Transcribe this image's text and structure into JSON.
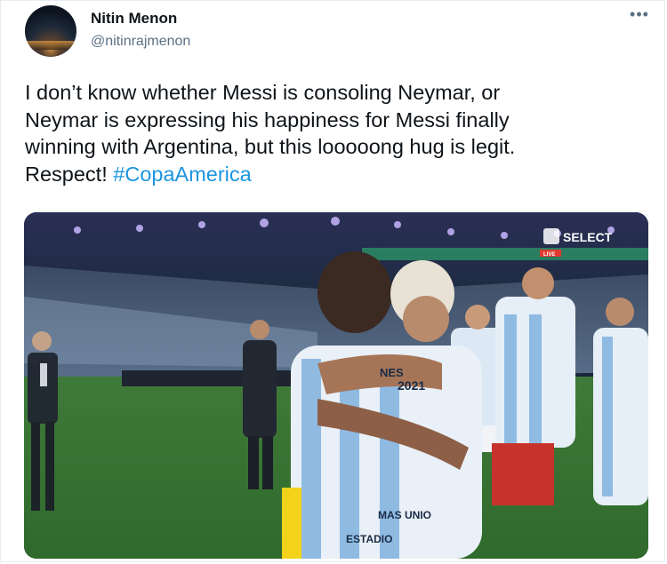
{
  "tweet": {
    "author_name": "Nitin Menon",
    "author_handle": "@nitinrajmenon",
    "more_icon": "more-horizontal-icon",
    "text": "I don’t know whether Messi is consoling Neymar, or\nNeymar is expressing his happiness for Messi finally\nwinning with Argentina, but this looooong hug is legit.\nRespect! ",
    "hashtag": "#CopaAmerica"
  },
  "media": {
    "broadcast_logo": "SELECT",
    "broadcast_logo_sub": "LIVE",
    "jersey_number": "2021",
    "jersey_text_1": "NES",
    "jersey_text_2": "MAS UNIO",
    "jersey_text_3": "ESTADIO"
  },
  "colors": {
    "hashtag": "#1b95e0",
    "secondary_text": "#5b7083"
  }
}
